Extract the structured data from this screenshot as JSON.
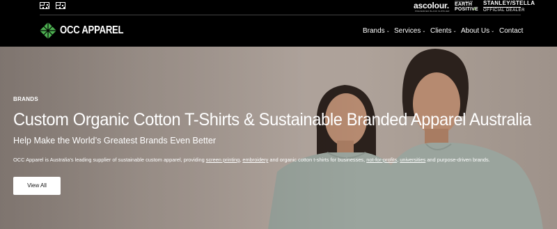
{
  "topbar": {
    "flags": [
      {
        "name": "australian-flag",
        "label": ""
      },
      {
        "name": "aboriginal-flag",
        "label": ""
      }
    ],
    "partners": {
      "ascolour": {
        "name": "ascolour.",
        "tagline": "PREFERRED BLANK SUPPLIER"
      },
      "earth_positive": {
        "top": "OFFICIAL DEALER",
        "line1": "EARTH",
        "line2": "POSITIVE",
        "check": "✓"
      },
      "stanley_stella": {
        "name": "STANLEY/STELLA",
        "tagline": "OFFICIAL DEALER"
      }
    }
  },
  "nav": {
    "logo_text": "OCC APPAREL",
    "items": [
      {
        "label": "Brands",
        "chevron": "⌄"
      },
      {
        "label": "Services",
        "chevron": "⌄"
      },
      {
        "label": "Clients",
        "chevron": "⌄"
      },
      {
        "label": "About Us",
        "chevron": "⌄"
      },
      {
        "label": "Contact",
        "chevron": ""
      }
    ]
  },
  "hero": {
    "kicker": "BRANDS",
    "title": "Custom Organic Cotton T-Shirts & Sustainable Branded Apparel Australia",
    "subtitle": "Help Make the World’s Greatest Brands Even Better",
    "body": {
      "prefix": "OCC Apparel is Australia’s leading supplier of sustainable custom apparel, providing ",
      "link1": "screen printing",
      "sep1": ", ",
      "link2": "embroidery",
      "mid": " and organic cotton t-shirts for businesses, ",
      "link3": "not-for-profits",
      "sep2": ", ",
      "link4": "universities",
      "suffix": " and purpose-driven brands."
    },
    "cta_label": "View All"
  },
  "colors": {
    "header_bg": "#000000",
    "logo_green": "#4caf50",
    "shirt": "#9aa49d",
    "skin": "#b68a70",
    "hair": "#2b211c"
  }
}
